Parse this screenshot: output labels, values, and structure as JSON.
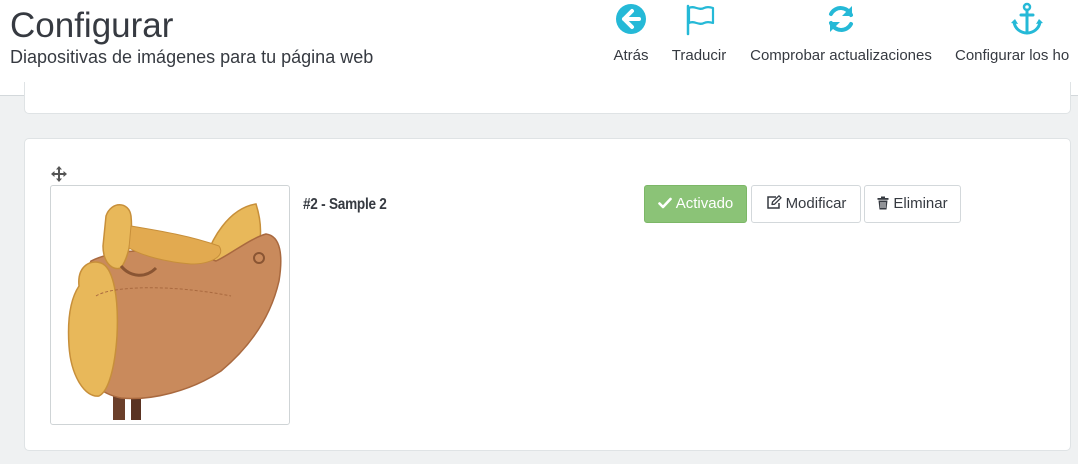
{
  "header": {
    "title": "Configurar",
    "subtitle": "Diapositivas de imágenes para tu página web"
  },
  "toolbar": {
    "items": [
      {
        "label": "Atrás",
        "icon": "arrow-circle-left-icon"
      },
      {
        "label": "Traducir",
        "icon": "flag-icon"
      },
      {
        "label": "Comprobar actualizaciones",
        "icon": "refresh-icon"
      },
      {
        "label": "Configurar los ho",
        "icon": "anchor-icon"
      }
    ]
  },
  "slide": {
    "title": "#2 - Sample 2",
    "image_alt": "saddle",
    "actions": {
      "status_label": "Activado",
      "edit_label": "Modificar",
      "delete_label": "Eliminar"
    }
  },
  "colors": {
    "accent": "#25b9d7",
    "success": "#8bc377",
    "text": "#363a41",
    "background": "#eff1f2"
  }
}
